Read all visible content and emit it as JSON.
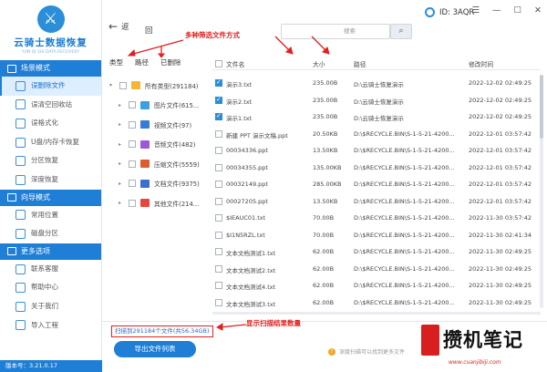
{
  "app": {
    "name": "云骑士数据恢复",
    "subtitle": "YUN QI SHI DATA RECOVERY",
    "version": "版本号：3.21.0.17"
  },
  "header": {
    "back_label": "返",
    "home_label": "回",
    "search_placeholder": "搜索",
    "id_label": "ID: 3AQR",
    "window_buttons": [
      "☰",
      "—",
      "☐",
      "✕"
    ]
  },
  "sidebar": {
    "sections": [
      {
        "title": "场景模式",
        "items": [
          "误删除文件",
          "误清空回收站",
          "误格式化",
          "U盘/内存卡恢复",
          "分区恢复",
          "深度恢复"
        ]
      },
      {
        "title": "向导模式",
        "items": [
          "常用位置",
          "磁盘分区"
        ]
      },
      {
        "title": "更多选项",
        "items": [
          "联系客服",
          "帮助中心",
          "关于我们",
          "导入工程"
        ]
      }
    ],
    "active_item": "误删除文件"
  },
  "tree": {
    "tabs": [
      "类型",
      "路径",
      "已删除"
    ],
    "items": [
      {
        "label": "所有类型(291184)",
        "icon_color": "#f5b731",
        "child": false,
        "icon": "folder-icon"
      },
      {
        "label": "图片文件(615...",
        "icon_color": "#3aa0e0",
        "child": true,
        "icon": "image-icon"
      },
      {
        "label": "视频文件(97)",
        "icon_color": "#3a7bd5",
        "child": true,
        "icon": "video-icon"
      },
      {
        "label": "音频文件(482)",
        "icon_color": "#9b59d6",
        "child": true,
        "icon": "audio-icon"
      },
      {
        "label": "压缩文件(5559)",
        "icon_color": "#e05a30",
        "child": true,
        "icon": "archive-icon"
      },
      {
        "label": "文档文件(9375)",
        "icon_color": "#3a6fd0",
        "child": true,
        "icon": "document-icon"
      },
      {
        "label": "其他文件(214...",
        "icon_color": "#e8463a",
        "child": true,
        "icon": "other-files-icon"
      }
    ]
  },
  "table": {
    "headers": {
      "name": "文件名",
      "size": "大小",
      "path": "路径",
      "time": "修改时间"
    },
    "rows": [
      {
        "name": "演示3.txt",
        "size": "235.00B",
        "path": "D:\\云骑士恢复演示",
        "time": "2022-12-02 02:49:25",
        "checked": true
      },
      {
        "name": "演示2.txt",
        "size": "235.00B",
        "path": "D:\\云骑士恢复演示",
        "time": "2022-12-02 02:49:25",
        "checked": true
      },
      {
        "name": "演示1.txt",
        "size": "235.00B",
        "path": "D:\\云骑士恢复演示",
        "time": "2022-12-02 02:49:25",
        "checked": true
      },
      {
        "name": "新建 PPT 演示文稿.ppt",
        "size": "20.50KB",
        "path": "D:\\$RECYCLE.BIN\\S-1-5-21-4200...",
        "time": "2022-12-01 03:57:42",
        "checked": false
      },
      {
        "name": "00034336.ppt",
        "size": "13.50KB",
        "path": "D:\\$RECYCLE.BIN\\S-1-5-21-4200...",
        "time": "2022-12-01 03:57:42",
        "checked": false
      },
      {
        "name": "00034355.ppt",
        "size": "135.00KB",
        "path": "D:\\$RECYCLE.BIN\\S-1-5-21-4200...",
        "time": "2022-12-01 03:57:42",
        "checked": false
      },
      {
        "name": "00032149.ppt",
        "size": "285.00KB",
        "path": "D:\\$RECYCLE.BIN\\S-1-5-21-4200...",
        "time": "2022-12-01 03:57:42",
        "checked": false
      },
      {
        "name": "00027205.ppt",
        "size": "13.50KB",
        "path": "D:\\$RECYCLE.BIN\\S-1-5-21-4200...",
        "time": "2022-12-01 03:57:42",
        "checked": false
      },
      {
        "name": "$IEAUC01.txt",
        "size": "70.00B",
        "path": "D:\\$RECYCLE.BIN\\S-1-5-21-4200...",
        "time": "2022-11-30 03:57:42",
        "checked": false
      },
      {
        "name": "$I1N5RZL.txt",
        "size": "70.00B",
        "path": "D:\\$RECYCLE.BIN\\S-1-5-21-4200...",
        "time": "2022-11-30 02:41:34",
        "checked": false
      },
      {
        "name": "文本文档测试1.txt",
        "size": "62.00B",
        "path": "D:\\$RECYCLE.BIN\\S-1-5-21-4200...",
        "time": "2022-11-30 02:49:25",
        "checked": false
      },
      {
        "name": "文本文档测试2.txt",
        "size": "62.00B",
        "path": "D:\\$RECYCLE.BIN\\S-1-5-21-4200...",
        "time": "2022-11-30 02:49:25",
        "checked": false
      },
      {
        "name": "文本文档测试4.txt",
        "size": "62.00B",
        "path": "D:\\$RECYCLE.BIN\\S-1-5-21-4200...",
        "time": "2022-11-30 02:49:25",
        "checked": false
      },
      {
        "name": "文本文档测试3.txt",
        "size": "62.00B",
        "path": "D:\\$RECYCLE.BIN\\S-1-5-21-4200...",
        "time": "2022-11-30 02:49:25",
        "checked": false
      }
    ]
  },
  "annotations": {
    "filter_note": "多种筛选文件方式",
    "count_note": "显示扫描结果数量"
  },
  "footer": {
    "scan_count": "扫描到291184个文件(共56.34GB)",
    "export_label": "导出文件列表",
    "tip": "深度扫描可以找到更多文件"
  },
  "watermark": {
    "text": "攒机笔记",
    "url": "www.cuanjibiji.com"
  }
}
